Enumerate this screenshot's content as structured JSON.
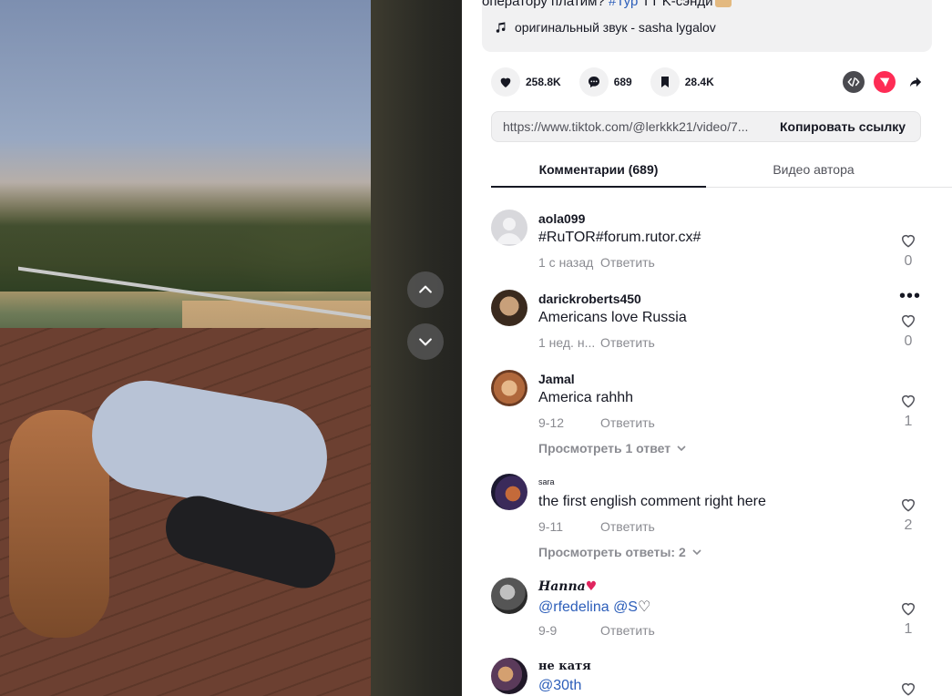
{
  "video": {
    "nav_up": "chevron-up",
    "nav_down": "chevron-down"
  },
  "description": {
    "text_before": "оператору платим?",
    "tag": "#Тур",
    "text_after": "TT K-сэнди"
  },
  "sound": {
    "label": "оригинальный звук - sasha lygalov"
  },
  "actions": {
    "likes": "258.8K",
    "comments": "689",
    "saves": "28.4K"
  },
  "share": {
    "embed_icon": "code-icon",
    "send_icon": "send-icon",
    "share_icon": "share-arrow-icon",
    "send_color": "#fe2c55"
  },
  "link": {
    "url": "https://www.tiktok.com/@lerkkk21/video/7...",
    "copy_label": "Копировать ссылку"
  },
  "tabs": [
    {
      "label": "Комментарии (689)",
      "active": true
    },
    {
      "label": "Видео автора",
      "active": false
    }
  ],
  "comments": [
    {
      "user": "aola099",
      "text": "#RuTOR#forum.rutor.cx#",
      "date": "1 с назад",
      "reply": "Ответить",
      "likes": "0"
    },
    {
      "user": "darickroberts450",
      "text": "Americans love Russia",
      "date": "1 нед. н...",
      "reply": "Ответить",
      "likes": "0"
    },
    {
      "user": "Jamal",
      "text": "America rahhh",
      "date": "9-12",
      "reply": "Ответить",
      "likes": "1",
      "view_replies": "Просмотреть 1 ответ"
    },
    {
      "user": "sara",
      "text": "the first english comment right here",
      "date": "9-11",
      "reply": "Ответить",
      "likes": "2",
      "view_replies": "Просмотреть ответы: 2"
    },
    {
      "user": "Hanna",
      "text_mention": "@rfedelina @S",
      "date": "9-9",
      "reply": "Ответить",
      "likes": "1"
    },
    {
      "user": "не катя",
      "text_mention": "@30th",
      "date": "",
      "reply": "",
      "likes": ""
    }
  ]
}
